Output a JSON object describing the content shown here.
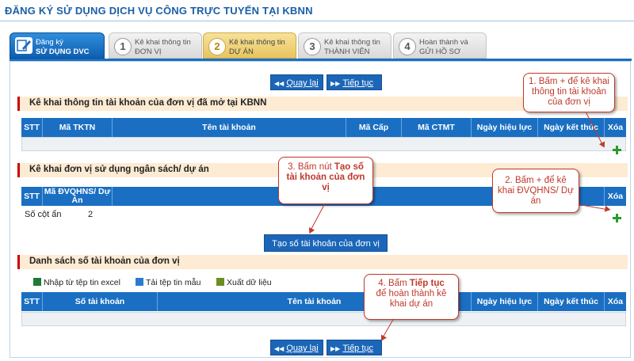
{
  "title": "ĐĂNG KÝ SỬ DỤNG DỊCH VỤ CÔNG TRỰC TUYẾN TẠI KBNN",
  "steps": [
    {
      "num": "",
      "line1": "Đăng ký",
      "line2": "SỬ DỤNG DVC",
      "icon": "edit-icon"
    },
    {
      "num": "1",
      "line1": "Kê khai thông tin",
      "line2": "ĐƠN VỊ"
    },
    {
      "num": "2",
      "line1": "Kê khai thông tin",
      "line2": "DỰ ÁN"
    },
    {
      "num": "3",
      "line1": "Kê khai thông tin",
      "line2": "THÀNH VIÊN"
    },
    {
      "num": "4",
      "line1": "Hoàn thành và",
      "line2": "GỬI HỒ SƠ"
    }
  ],
  "buttons": {
    "back": "Quay lại",
    "next": "Tiếp tục",
    "create_accounts": "Tạo số tài khoản của đơn vị"
  },
  "section1": {
    "title": "Kê khai thông tin tài khoản của đơn vị đã mở tại KBNN",
    "columns": [
      "STT",
      "Mã TKTN",
      "Tên tài khoản",
      "Mã Cấp",
      "Mã CTMT",
      "Ngày hiệu lực",
      "Ngày kết thúc",
      "Xóa"
    ]
  },
  "section2": {
    "title": "Kê khai đơn vị sử dụng ngân sách/ dự án",
    "columns": [
      "STT",
      "Mã ĐVQHNS/ Dự Án",
      "Dự án",
      "Xóa"
    ],
    "hidden_label": "Số cột ẩn",
    "hidden_value": "2"
  },
  "section3": {
    "title": "Danh sách số tài khoản của đơn vị",
    "toolbar": [
      "Nhập từ tệp tin excel",
      "Tải tệp tin mẫu",
      "Xuất dữ liệu"
    ],
    "columns": [
      "STT",
      "Số tài khoản",
      "Tên tài khoản",
      "Ngày hiệu lực",
      "Ngày kết thúc",
      "Xóa"
    ]
  },
  "callouts": {
    "c1": "1. Bấm + để kê khai thông tin tài khoản của đơn vị",
    "c2": "2. Bấm + để kê khai ĐVQHNS/ Dự án",
    "c3_pre": "3. Bấm nút ",
    "c3_bold": "Tạo số tài khoản của đơn vị",
    "c4_pre": "4. Bấm ",
    "c4_bold": "Tiếp tục",
    "c4_post": "để hoàn thành kê khai dự án"
  },
  "colors": {
    "accent": "#1a6fc2",
    "section_bg": "#fdebd3",
    "callout": "#c0392b",
    "add": "#2a9a2a"
  }
}
